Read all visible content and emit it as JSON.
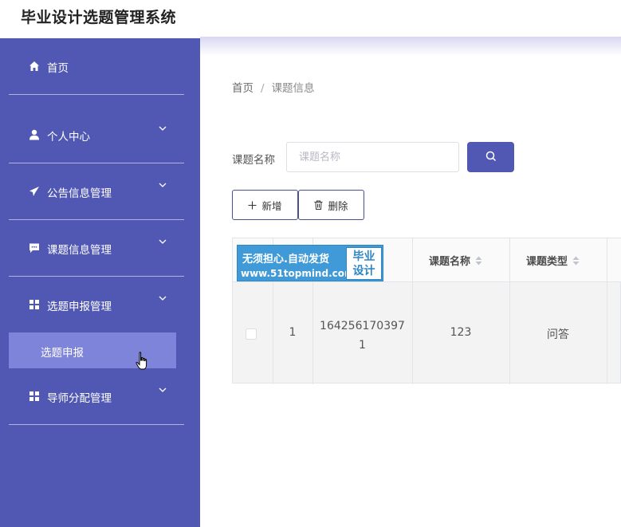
{
  "app": {
    "title": "毕业设计选题管理系统"
  },
  "sidebar": {
    "items": [
      {
        "label": "首页",
        "icon": "home-icon"
      },
      {
        "label": "个人中心",
        "icon": "user-icon"
      },
      {
        "label": "公告信息管理",
        "icon": "send-icon"
      },
      {
        "label": "课题信息管理",
        "icon": "message-icon"
      },
      {
        "label": "选题申报管理",
        "icon": "grid-icon"
      },
      {
        "label": "导师分配管理",
        "icon": "grid-icon"
      }
    ],
    "active_sub_item": "选题申报"
  },
  "breadcrumb": {
    "home": "首页",
    "current": "课题信息"
  },
  "search": {
    "label": "课题名称",
    "placeholder": "课题名称",
    "value": ""
  },
  "toolbar": {
    "add_label": "新增",
    "delete_label": "删除"
  },
  "table": {
    "headers": [
      "课题名称",
      "课题类型"
    ],
    "rows": [
      {
        "index": "1",
        "id_line1": "164256170397",
        "id_line2": "1",
        "name": "123",
        "type": "问答"
      }
    ]
  },
  "watermark": {
    "line1": "无须担心.自动发货",
    "line2": "www.51topmind.com",
    "box_line1": "毕业",
    "box_line2": "设计"
  },
  "colors": {
    "sidebar": "#5158b3",
    "sidebar_active": "#7d84d9",
    "primary": "#5158b3",
    "watermark": "#3f9ad7"
  }
}
